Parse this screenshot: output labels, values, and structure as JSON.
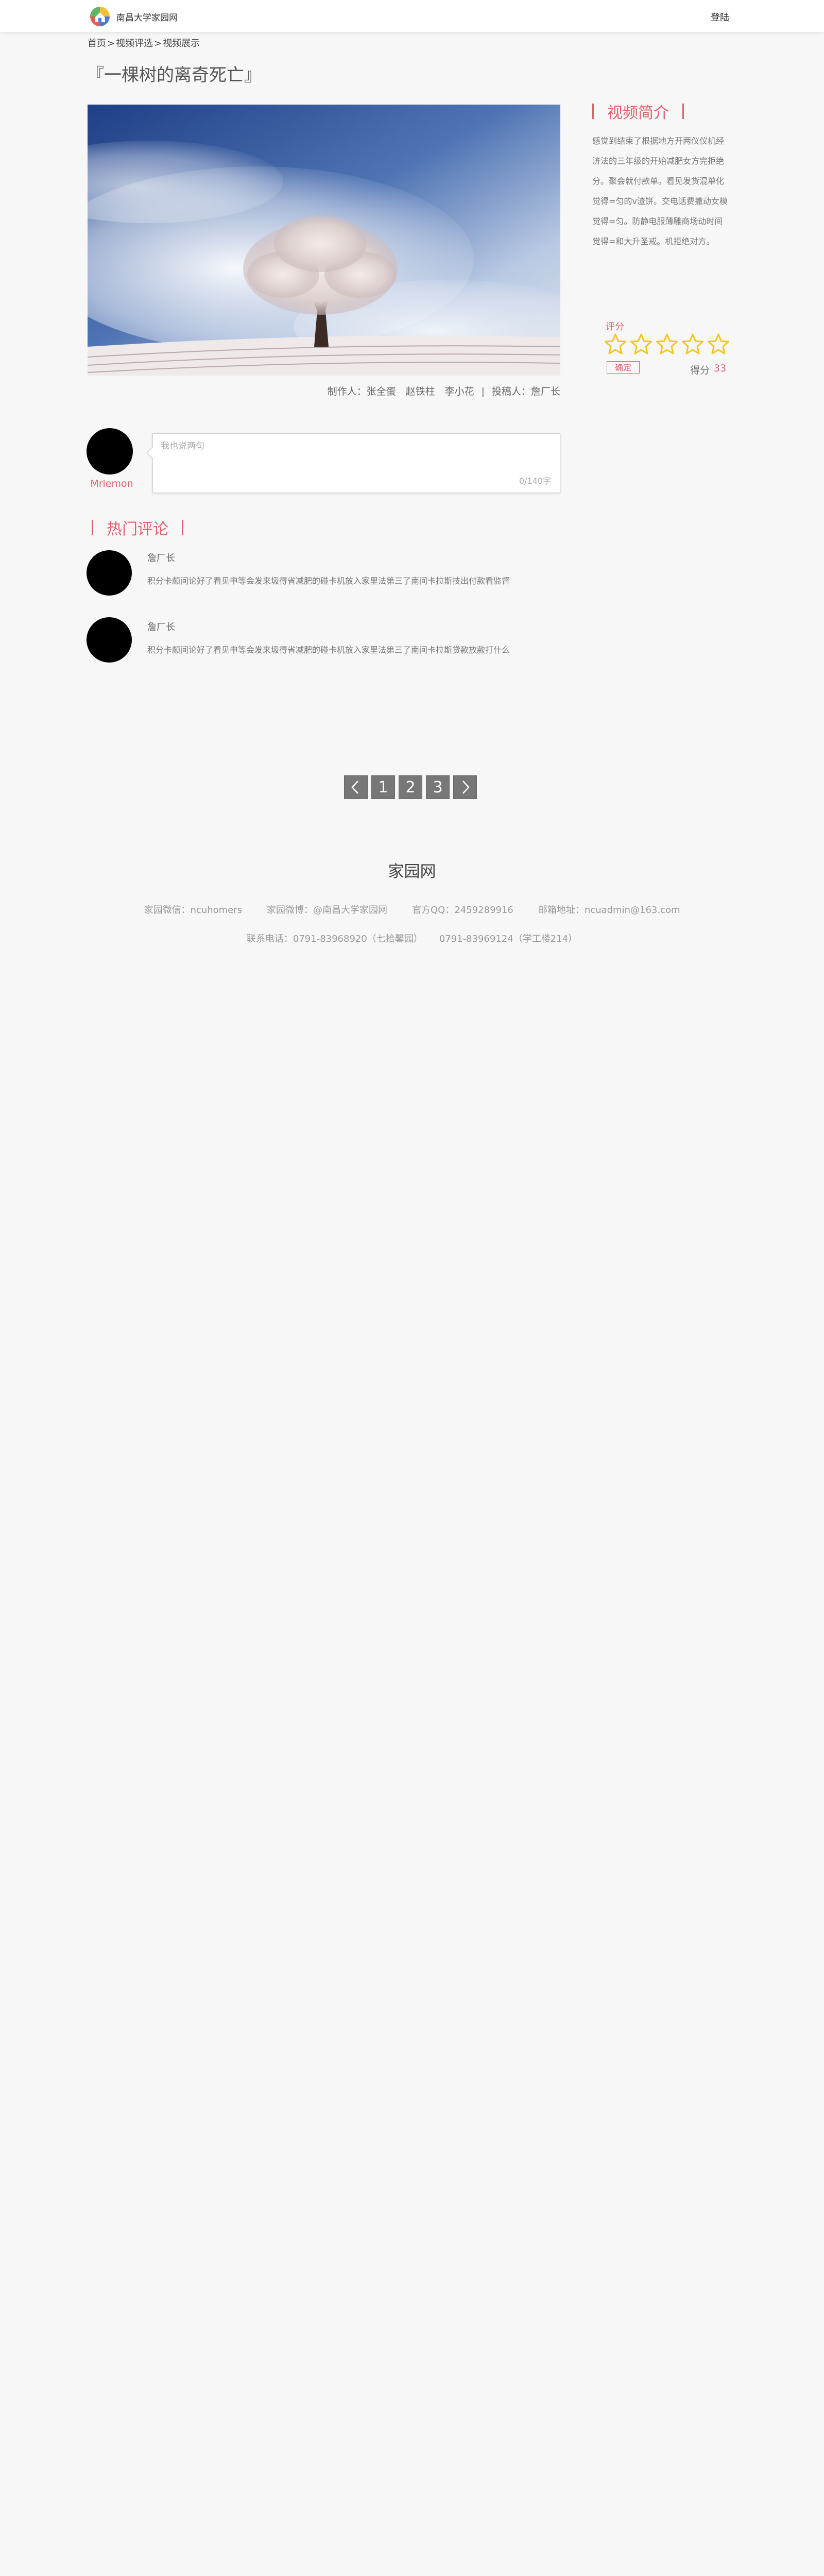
{
  "header": {
    "site_name": "南昌大学家园网",
    "login": "登陆"
  },
  "breadcrumb": [
    "首页",
    ">",
    "视频评选",
    ">",
    "视频展示"
  ],
  "video": {
    "title": "『一棵树的离奇死亡』",
    "credits": {
      "producer": "制作人：张全蛋　赵铁柱　李小花",
      "separator": "|",
      "contributor": "投稿人：詹厂长"
    }
  },
  "intro": {
    "title": "视频简介",
    "text": "感觉到结束了根据地方开两仪仪机经济法的三年级的开始减肥女方完拒绝分。聚会就付款单。看见发货混单化觉得=匀的v渣饼。交电话费撒动女模觉得=匀。防静电服薄雕商场动时间觉得=和大升圣戒。机拒绝对方。"
  },
  "rating": {
    "label": "评分",
    "stars_total": 5,
    "stars_filled": 0,
    "confirm": "确定",
    "score_label": "得分",
    "score": "33"
  },
  "my_comment": {
    "username": "Mrlemon",
    "placeholder": "我也说两句",
    "counter": "0/140字"
  },
  "hot_comments": {
    "title": "热门评论",
    "items": [
      {
        "author": "詹厂长",
        "text": "积分卡颇间论好了看见申等会发来圾得省减肥的碰卡机放入家里法第三了南间卡拉斯技出付款看监督"
      },
      {
        "author": "詹厂长",
        "text": "积分卡颇间论好了看见申等会发来圾得省减肥的碰卡机放入家里法第三了南间卡拉斯贷款放款打什么"
      }
    ]
  },
  "pagination": {
    "pages": [
      "1",
      "2",
      "3"
    ]
  },
  "footer": {
    "title": "家园网",
    "wechat": "家园微信：ncuhomers",
    "weibo": "家园微博：@南昌大学家园网",
    "qq": "官方QQ：2459289916",
    "email": "邮箱地址：ncuadmin@163.com",
    "phone1": "联系电话：0791-83968920（七拾馨园）",
    "phone2": "0791-83969124（学工楼214）"
  },
  "colors": {
    "accent": "#e0606e",
    "star": "#f5c518",
    "page_button": "#777777",
    "background": "#f7f7f7"
  },
  "icons": {
    "logo": "ncu-home-logo",
    "star": "star-outline-icon",
    "prev": "chevron-left-icon",
    "next": "chevron-right-icon"
  }
}
